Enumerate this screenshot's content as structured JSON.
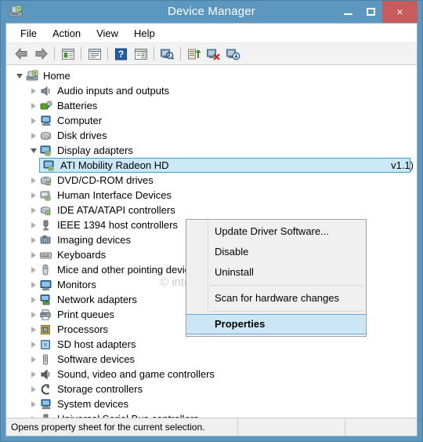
{
  "window": {
    "title": "Device Manager",
    "icon": "device-manager-icon",
    "controls": {
      "minimize": "minimize-button",
      "maximize": "maximize-button",
      "close_label": "×"
    },
    "accent_titlebar": "#5b97be",
    "accent_close": "#c75c5c",
    "selection_fill": "#cbe8f7",
    "selection_border": "#3aa0d0"
  },
  "menubar": {
    "items": [
      {
        "label": "File",
        "name": "menu-file"
      },
      {
        "label": "Action",
        "name": "menu-action"
      },
      {
        "label": "View",
        "name": "menu-view"
      },
      {
        "label": "Help",
        "name": "menu-help"
      }
    ]
  },
  "toolbar": {
    "buttons": [
      {
        "name": "back-button",
        "icon": "back-arrow-icon"
      },
      {
        "name": "forward-button",
        "icon": "forward-arrow-icon"
      },
      {
        "name": "show-hide-console-tree-button",
        "icon": "console-tree-icon"
      },
      {
        "name": "properties-button",
        "icon": "properties-window-icon"
      },
      {
        "name": "help-button",
        "icon": "question-mark-icon"
      },
      {
        "name": "show-hide-action-pane-button",
        "icon": "action-pane-icon"
      },
      {
        "name": "scan-hardware-changes-button",
        "icon": "scan-magnifier-icon"
      },
      {
        "name": "update-driver-button",
        "icon": "update-driver-icon"
      },
      {
        "name": "uninstall-device-button",
        "icon": "uninstall-red-x-icon"
      },
      {
        "name": "disable-device-button",
        "icon": "disable-device-icon"
      }
    ]
  },
  "tree": {
    "root": {
      "label": "Home",
      "icon": "computer-home-icon",
      "expanded": true
    },
    "items": [
      {
        "label": "Audio inputs and outputs",
        "icon": "speaker-icon",
        "expanded": false
      },
      {
        "label": "Batteries",
        "icon": "battery-icon",
        "expanded": false
      },
      {
        "label": "Computer",
        "icon": "computer-icon",
        "expanded": false
      },
      {
        "label": "Disk drives",
        "icon": "disk-drive-icon",
        "expanded": false
      },
      {
        "label": "Display adapters",
        "icon": "display-adapter-icon",
        "expanded": true
      },
      {
        "label": "DVD/CD-ROM drives",
        "icon": "optical-drive-icon",
        "expanded": false
      },
      {
        "label": "Human Interface Devices",
        "icon": "hid-icon",
        "expanded": false
      },
      {
        "label": "IDE ATA/ATAPI controllers",
        "icon": "ide-controller-icon",
        "expanded": false
      },
      {
        "label": "IEEE 1394 host controllers",
        "icon": "firewire-icon",
        "expanded": false
      },
      {
        "label": "Imaging devices",
        "icon": "camera-icon",
        "expanded": false
      },
      {
        "label": "Keyboards",
        "icon": "keyboard-icon",
        "expanded": false
      },
      {
        "label": "Mice and other pointing devices",
        "icon": "mouse-icon",
        "expanded": false
      },
      {
        "label": "Monitors",
        "icon": "monitor-icon",
        "expanded": false
      },
      {
        "label": "Network adapters",
        "icon": "network-adapter-icon",
        "expanded": false
      },
      {
        "label": "Print queues",
        "icon": "printer-icon",
        "expanded": false
      },
      {
        "label": "Processors",
        "icon": "processor-icon",
        "expanded": false
      },
      {
        "label": "SD host adapters",
        "icon": "sd-card-icon",
        "expanded": false
      },
      {
        "label": "Software devices",
        "icon": "software-device-icon",
        "expanded": false
      },
      {
        "label": "Sound, video and game controllers",
        "icon": "sound-controller-icon",
        "expanded": false
      },
      {
        "label": "Storage controllers",
        "icon": "storage-controller-icon",
        "expanded": false
      },
      {
        "label": "System devices",
        "icon": "system-device-icon",
        "expanded": false
      },
      {
        "label": "Universal Serial Bus controllers",
        "icon": "usb-icon",
        "expanded": false
      }
    ],
    "selected_device": {
      "label": "ATI Mobility Radeon HD",
      "tail": "v1.1)",
      "icon": "display-adapter-icon"
    }
  },
  "context_menu": {
    "items": [
      {
        "label": "Update Driver Software...",
        "name": "ctx-update-driver-software",
        "highlighted": false
      },
      {
        "label": "Disable",
        "name": "ctx-disable",
        "highlighted": false
      },
      {
        "label": "Uninstall",
        "name": "ctx-uninstall",
        "highlighted": false
      },
      {
        "label": "Scan for hardware changes",
        "name": "ctx-scan-for-hardware-changes",
        "highlighted": false
      },
      {
        "label": "Properties",
        "name": "ctx-properties",
        "highlighted": true
      }
    ]
  },
  "statusbar": {
    "message": "Opens property sheet for the current selection.",
    "pane2": "",
    "pane3": ""
  },
  "watermark": {
    "text": "© intowindows.com"
  }
}
